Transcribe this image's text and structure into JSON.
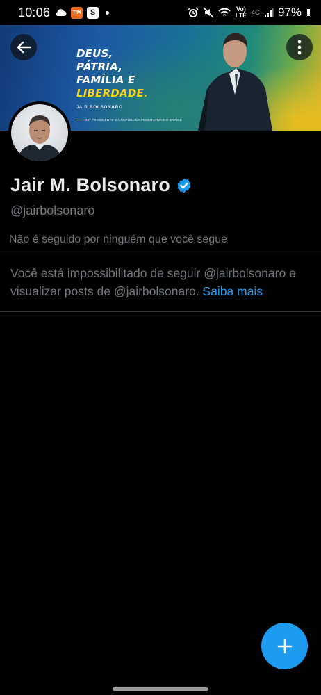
{
  "status_bar": {
    "time": "10:06",
    "orange_badge": "TIM",
    "white_badge": "S",
    "network": "Vo) LTE",
    "network_gen": "4G",
    "battery": "97%"
  },
  "banner": {
    "line1": "DEUS,",
    "line2": "PÁTRIA,",
    "line3": "FAMÍLIA E",
    "line4": "LIBERDADE.",
    "sign_first": "JAIR",
    "sign_last": "BOLSONARO",
    "footer": "38º PRESIDENTE DA REPÚBLICA FEDERATIVA DO BRASIL"
  },
  "profile": {
    "display_name": "Jair M. Bolsonaro",
    "handle": "@jairbolsonaro",
    "followed_by": "Não é seguido por ninguém que você segue",
    "blocked_text": "Você está impossibilitado de seguir @jairbolsonaro e visualizar posts de @jairbolsonaro.",
    "learn_more": "Saiba mais"
  },
  "colors": {
    "accent": "#1d9bf0",
    "background": "#000000",
    "secondary_text": "#71767b"
  },
  "icons": {
    "back": "arrow-left-icon",
    "more": "more-vertical-icon",
    "verified": "verified-badge-icon",
    "compose": "plus-icon"
  }
}
